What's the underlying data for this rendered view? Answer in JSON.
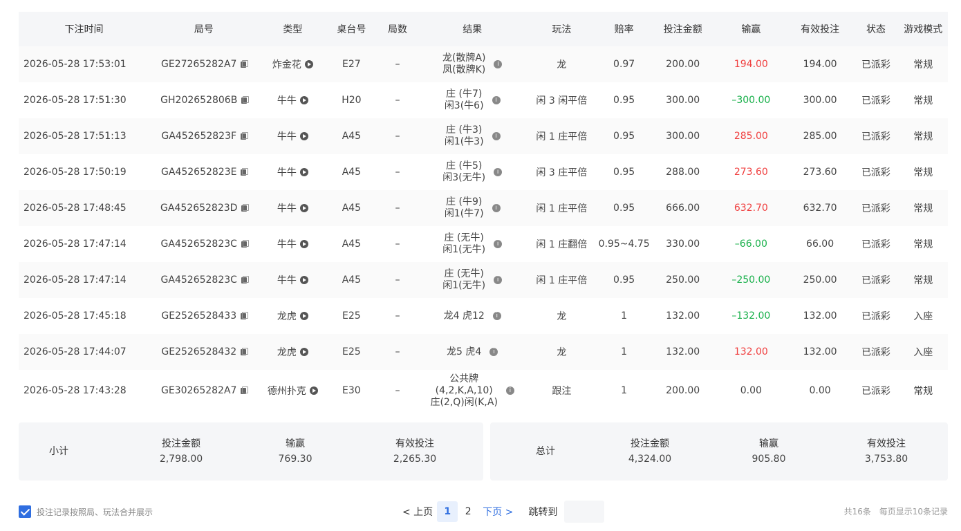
{
  "table": {
    "headers": [
      "下注时间",
      "局号",
      "类型",
      "桌台号",
      "局数",
      "结果",
      "玩法",
      "赔率",
      "投注金额",
      "输赢",
      "有效投注",
      "状态",
      "游戏模式"
    ],
    "rows": [
      {
        "time": "2026-05-28 17:53:01",
        "round": "GE27265282A7",
        "type": "炸金花",
        "table": "E27",
        "count": "–",
        "result": [
          "龙(散牌A)",
          "凤(散牌K)"
        ],
        "play": "龙",
        "odds": "0.97",
        "bet": "200.00",
        "win": "194.00",
        "win_color": "red",
        "valid": "194.00",
        "status": "已派彩",
        "mode": "常规"
      },
      {
        "time": "2026-05-28 17:51:30",
        "round": "GH202652806B",
        "type": "牛牛",
        "table": "H20",
        "count": "–",
        "result": [
          "庄 (牛7)",
          "闲3(牛6)"
        ],
        "play": "闲 3 闲平倍",
        "odds": "0.95",
        "bet": "300.00",
        "win": "–300.00",
        "win_color": "green",
        "valid": "300.00",
        "status": "已派彩",
        "mode": "常规"
      },
      {
        "time": "2026-05-28 17:51:13",
        "round": "GA452652823F",
        "type": "牛牛",
        "table": "A45",
        "count": "–",
        "result": [
          "庄 (牛3)",
          "闲1(牛3)"
        ],
        "play": "闲 1 庄平倍",
        "odds": "0.95",
        "bet": "300.00",
        "win": "285.00",
        "win_color": "red",
        "valid": "285.00",
        "status": "已派彩",
        "mode": "常规"
      },
      {
        "time": "2026-05-28 17:50:19",
        "round": "GA452652823E",
        "type": "牛牛",
        "table": "A45",
        "count": "–",
        "result": [
          "庄 (牛5)",
          "闲3(无牛)"
        ],
        "play": "闲 3 庄平倍",
        "odds": "0.95",
        "bet": "288.00",
        "win": "273.60",
        "win_color": "red",
        "valid": "273.60",
        "status": "已派彩",
        "mode": "常规"
      },
      {
        "time": "2026-05-28 17:48:45",
        "round": "GA452652823D",
        "type": "牛牛",
        "table": "A45",
        "count": "–",
        "result": [
          "庄 (牛9)",
          "闲1(牛7)"
        ],
        "play": "闲 1 庄平倍",
        "odds": "0.95",
        "bet": "666.00",
        "win": "632.70",
        "win_color": "red",
        "valid": "632.70",
        "status": "已派彩",
        "mode": "常规"
      },
      {
        "time": "2026-05-28 17:47:14",
        "round": "GA452652823C",
        "type": "牛牛",
        "table": "A45",
        "count": "–",
        "result": [
          "庄 (无牛)",
          "闲1(无牛)"
        ],
        "play": "闲 1 庄翻倍",
        "odds": "0.95~4.75",
        "bet": "330.00",
        "win": "–66.00",
        "win_color": "green",
        "valid": "66.00",
        "status": "已派彩",
        "mode": "常规"
      },
      {
        "time": "2026-05-28 17:47:14",
        "round": "GA452652823C",
        "type": "牛牛",
        "table": "A45",
        "count": "–",
        "result": [
          "庄 (无牛)",
          "闲1(无牛)"
        ],
        "play": "闲 1 庄平倍",
        "odds": "0.95",
        "bet": "250.00",
        "win": "–250.00",
        "win_color": "green",
        "valid": "250.00",
        "status": "已派彩",
        "mode": "常规"
      },
      {
        "time": "2026-05-28 17:45:18",
        "round": "GE2526528433",
        "type": "龙虎",
        "table": "E25",
        "count": "–",
        "result": [
          "龙4 虎12"
        ],
        "play": "龙",
        "odds": "1",
        "bet": "132.00",
        "win": "–132.00",
        "win_color": "green",
        "valid": "132.00",
        "status": "已派彩",
        "mode": "入座"
      },
      {
        "time": "2026-05-28 17:44:07",
        "round": "GE2526528432",
        "type": "龙虎",
        "table": "E25",
        "count": "–",
        "result": [
          "龙5 虎4"
        ],
        "play": "龙",
        "odds": "1",
        "bet": "132.00",
        "win": "132.00",
        "win_color": "red",
        "valid": "132.00",
        "status": "已派彩",
        "mode": "入座"
      },
      {
        "time": "2026-05-28 17:43:28",
        "round": "GE30265282A7",
        "type": "德州扑克",
        "table": "E30",
        "count": "–",
        "result": [
          "公共牌",
          "(4,2,K,A,10)",
          "庄(2,Q)闲(K,A)"
        ],
        "play": "跟注",
        "odds": "1",
        "bet": "200.00",
        "win": "0.00",
        "win_color": "none",
        "valid": "0.00",
        "status": "已派彩",
        "mode": "常规"
      }
    ]
  },
  "subtotal": {
    "title": "小计",
    "bet_label": "投注金额",
    "bet": "2,798.00",
    "win_label": "输赢",
    "win": "769.30",
    "valid_label": "有效投注",
    "valid": "2,265.30"
  },
  "total": {
    "title": "总计",
    "bet_label": "投注金额",
    "bet": "4,324.00",
    "win_label": "输赢",
    "win": "905.80",
    "valid_label": "有效投注",
    "valid": "3,753.80"
  },
  "footer": {
    "merge_label": "投注记录按照局、玩法合并展示",
    "merge_checked": true,
    "prev": "< 上页",
    "pages": [
      "1",
      "2"
    ],
    "next": "下页 >",
    "jump_label": "跳转到",
    "total_count": "共16条",
    "per_page": "每页显示10条记录"
  },
  "icons": {
    "copy": "copy-icon",
    "play": "play-icon",
    "info": "info-icon",
    "check": "checkbox-check-icon"
  },
  "colors": {
    "win": "#f04040",
    "loss": "#18b04a",
    "accent": "#2f6ee0"
  }
}
